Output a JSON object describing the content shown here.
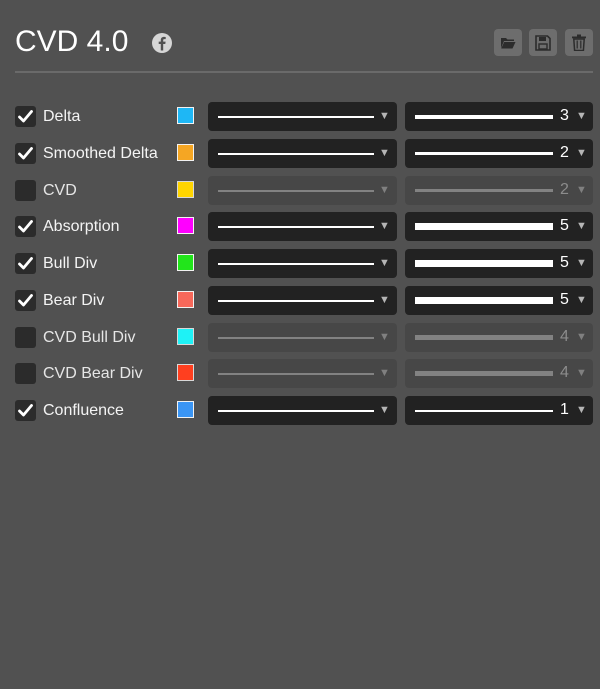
{
  "header": {
    "title": "CVD 4.0",
    "icons": [
      "facebook-icon",
      "folder-open-icon",
      "save-disk-icon",
      "trash-icon"
    ]
  },
  "rows": [
    {
      "label": "Delta",
      "checked": true,
      "color": "#1EB7F5",
      "line_width": "3"
    },
    {
      "label": "Smoothed Delta",
      "checked": true,
      "color": "#F5A623",
      "line_width": "2"
    },
    {
      "label": "CVD",
      "checked": false,
      "color": "#FFD500",
      "line_width": "2"
    },
    {
      "label": "Absorption",
      "checked": true,
      "color": "#FF00FF",
      "line_width": "5"
    },
    {
      "label": "Bull Div",
      "checked": true,
      "color": "#22E51B",
      "line_width": "5"
    },
    {
      "label": "Bear Div",
      "checked": true,
      "color": "#F7685A",
      "line_width": "5"
    },
    {
      "label": "CVD Bull Div",
      "checked": false,
      "color": "#1EF2F6",
      "line_width": "4"
    },
    {
      "label": "CVD Bear Div",
      "checked": false,
      "color": "#FF3F1F",
      "line_width": "4"
    },
    {
      "label": "Confluence",
      "checked": true,
      "color": "#3A95F4",
      "line_width": "1"
    }
  ]
}
